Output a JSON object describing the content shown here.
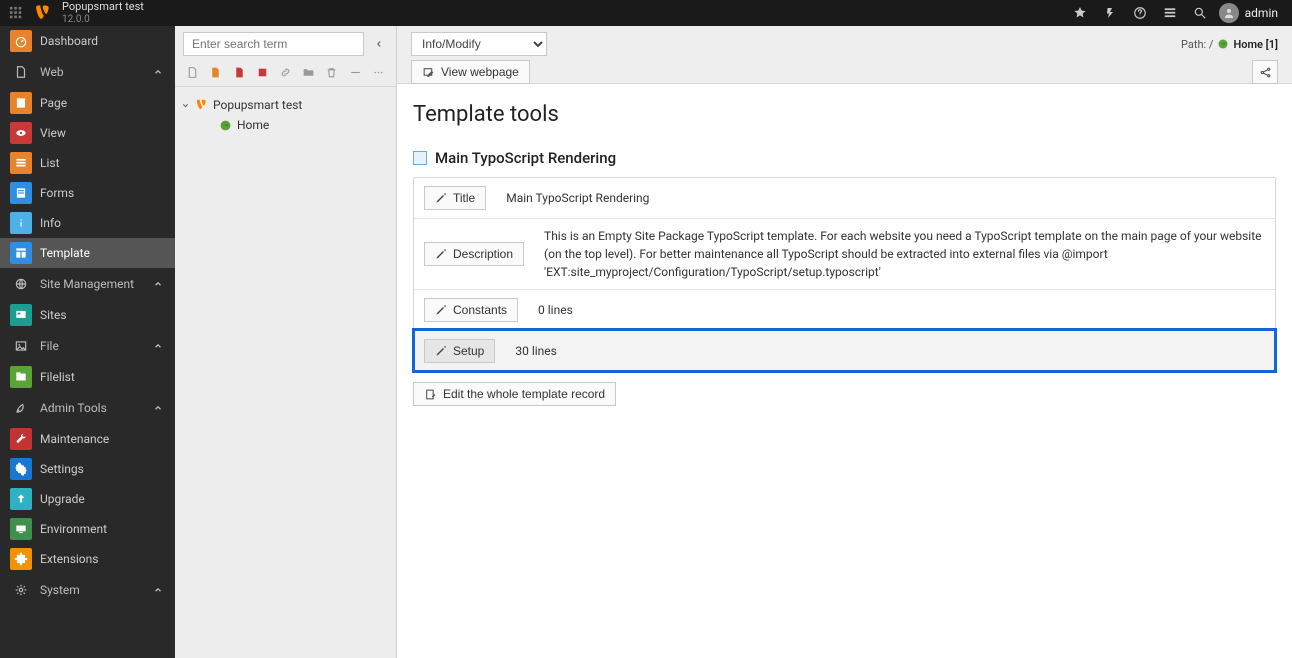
{
  "topbar": {
    "site_name": "Popupsmart test",
    "version": "12.0.0",
    "user_label": "admin"
  },
  "modmenu": {
    "dashboard": "Dashboard",
    "group_web": "Web",
    "page": "Page",
    "view": "View",
    "list": "List",
    "forms": "Forms",
    "info": "Info",
    "template": "Template",
    "group_site": "Site Management",
    "sites": "Sites",
    "group_file": "File",
    "filelist": "Filelist",
    "group_admin": "Admin Tools",
    "maintenance": "Maintenance",
    "settings": "Settings",
    "upgrade": "Upgrade",
    "environment": "Environment",
    "extensions": "Extensions",
    "group_system": "System"
  },
  "tree": {
    "search_placeholder": "Enter search term",
    "root": "Popupsmart test",
    "child1": "Home"
  },
  "doc": {
    "selector_value": "Info/Modify",
    "view_webpage": "View webpage",
    "path_prefix": "Path: / ",
    "path_page": "Home [1]",
    "heading": "Template tools",
    "section_title": "Main TypoScript Rendering",
    "rows": {
      "title_btn": "Title",
      "title_val": "Main TypoScript Rendering",
      "desc_btn": "Description",
      "desc_val": "This is an Empty Site Package TypoScript template. For each website you need a TypoScript template on the main page of your website (on the top level). For better maintenance all TypoScript should be extracted into external files via @import 'EXT:site_myproject/Configuration/TypoScript/setup.typoscript'",
      "constants_btn": "Constants",
      "constants_val": "0 lines",
      "setup_btn": "Setup",
      "setup_val": "30 lines",
      "edit_whole": "Edit the whole template record"
    }
  }
}
